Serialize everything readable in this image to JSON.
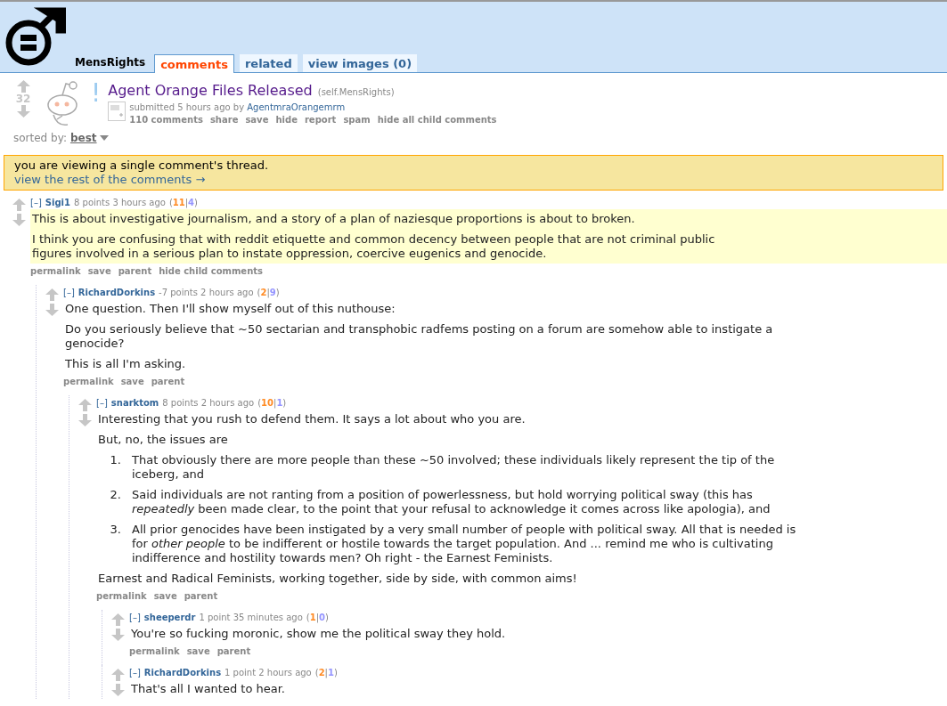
{
  "header": {
    "subreddit": "MensRights",
    "tabs": [
      {
        "label": "comments",
        "selected": true
      },
      {
        "label": "related",
        "selected": false
      },
      {
        "label": "view images (0)",
        "selected": false
      }
    ]
  },
  "post": {
    "score": "32",
    "mark": "!",
    "title": "Agent Orange Files Released",
    "domain": "(self.MensRights)",
    "submitted": "submitted 5 hours ago by",
    "author": "AgentmraOrangemrm",
    "buttons": [
      "110 comments",
      "share",
      "save",
      "hide",
      "report",
      "spam",
      "hide all child comments"
    ]
  },
  "vote_punct": {
    "open": "(",
    "sep": "|",
    "close": ")"
  },
  "sort": {
    "label": "sorted by:",
    "value": "best"
  },
  "notice": {
    "text": "you are viewing a single comment's thread.",
    "link": "view the rest of the comments →"
  },
  "comments": [
    {
      "collapse": "[–]",
      "author": "Sigi1",
      "points": "8 points 3 hours ago",
      "ups": "11",
      "downs": "4",
      "highlighted": true,
      "blocks": [
        {
          "kind": "p",
          "text": "This is about investigative journalism, and a story of a plan of naziesque proportions is about to broken."
        },
        {
          "kind": "p",
          "text": "I think you are confusing that with reddit etiquette and common decency between people that are not criminal public figures involved in a serious plan to instate oppression, coercive eugenics and genocide."
        }
      ],
      "buttons": [
        "permalink",
        "save",
        "parent",
        "hide child comments"
      ],
      "children": [
        {
          "collapse": "[–]",
          "author": "RichardDorkins",
          "points": "-7 points 2 hours ago",
          "ups": "2",
          "downs": "9",
          "highlighted": false,
          "blocks": [
            {
              "kind": "p",
              "text": "One question. Then I'll show myself out of this nuthouse:"
            },
            {
              "kind": "p",
              "text": "Do you seriously believe that ~50 sectarian and transphobic radfems posting on a forum are somehow able to instigate a genocide?"
            },
            {
              "kind": "p",
              "text": "This is all I'm asking."
            }
          ],
          "buttons": [
            "permalink",
            "save",
            "parent"
          ],
          "children": [
            {
              "collapse": "[–]",
              "author": "snarktom",
              "points": "8 points 2 hours ago",
              "ups": "10",
              "downs": "1",
              "highlighted": false,
              "blocks": [
                {
                  "kind": "p",
                  "text": "Interesting that you rush to defend them. It says a lot about who you are."
                },
                {
                  "kind": "p",
                  "text": "But, no, the issues are"
                },
                {
                  "kind": "ol",
                  "items": [
                    {
                      "number": "1.",
                      "text": "That obviously there are more people than these ~50 involved; these individuals likely represent the tip of the iceberg, and"
                    },
                    {
                      "number": "2.",
                      "text": "Said individuals are not ranting from a position of powerlessness, but hold worrying political sway (this has *repeatedly* been made clear, to the point that your refusal to acknowledge it comes across like apologia), and"
                    },
                    {
                      "number": "3.",
                      "text": "All prior genocides have been instigated by a very small number of people with political sway. All that is needed is for *other people* to be indifferent or hostile towards the target population. And ... remind me who is cultivating indifference and hostility towards men? Oh right - the Earnest Feminists."
                    }
                  ]
                },
                {
                  "kind": "p",
                  "text": "Earnest and Radical Feminists, working together, side by side, with common aims!"
                }
              ],
              "buttons": [
                "permalink",
                "save",
                "parent"
              ],
              "children": [
                {
                  "collapse": "[–]",
                  "author": "sheeperdr",
                  "points": "1 point 35 minutes ago",
                  "ups": "1",
                  "downs": "0",
                  "highlighted": false,
                  "blocks": [
                    {
                      "kind": "p",
                      "text": "You're so fucking moronic, show me the political sway they hold."
                    }
                  ],
                  "buttons": [
                    "permalink",
                    "save",
                    "parent"
                  ]
                },
                {
                  "collapse": "[–]",
                  "author": "RichardDorkins",
                  "points": "1 point 2 hours ago",
                  "ups": "2",
                  "downs": "1",
                  "highlighted": false,
                  "blocks": [
                    {
                      "kind": "p",
                      "text": "That's all I wanted to hear."
                    }
                  ]
                }
              ]
            }
          ]
        }
      ]
    }
  ]
}
